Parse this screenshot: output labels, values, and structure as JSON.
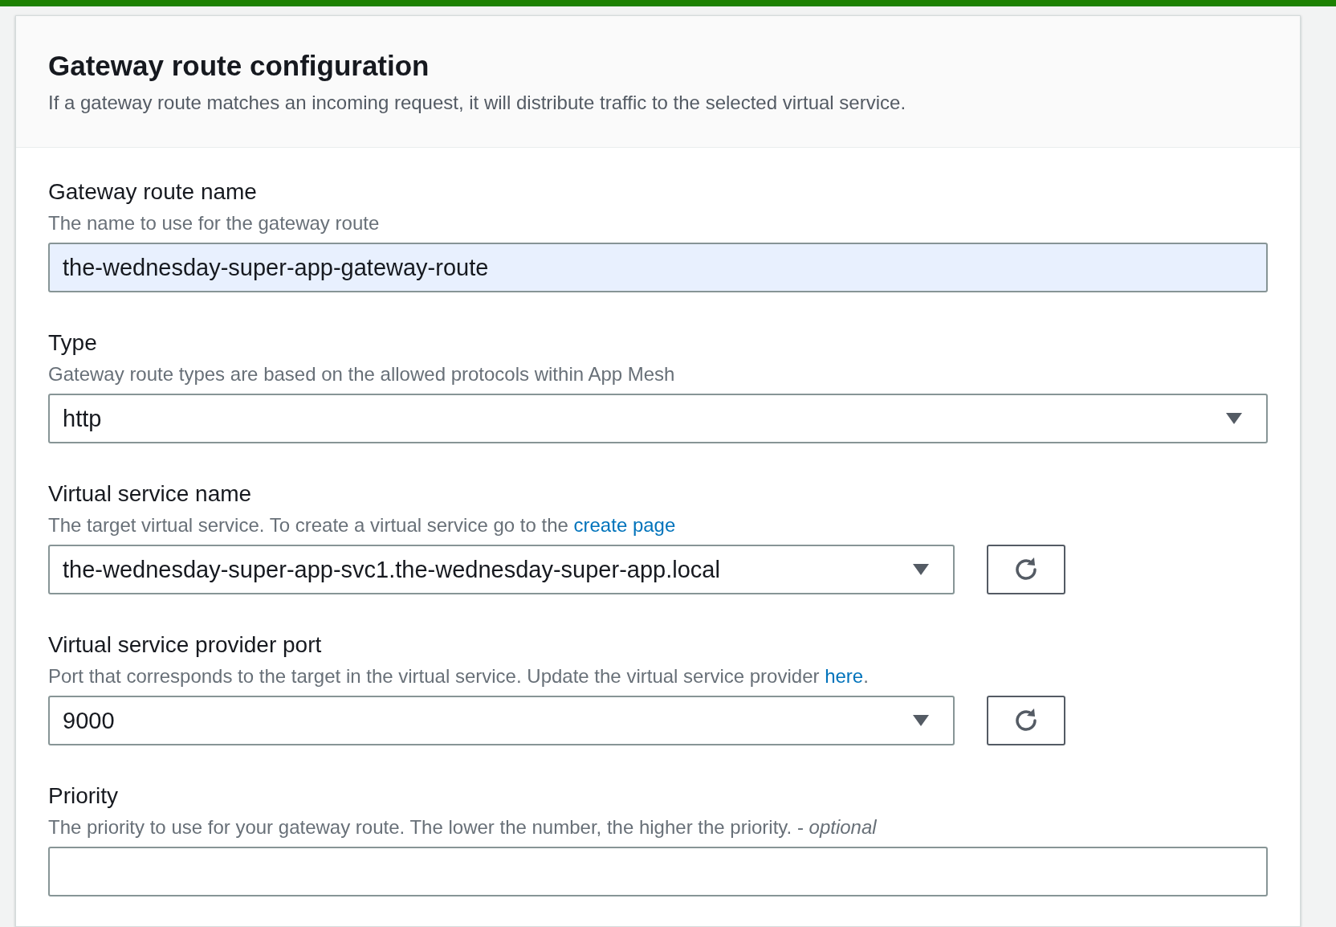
{
  "header": {
    "title": "Gateway route configuration",
    "description": "If a gateway route matches an incoming request, it will distribute traffic to the selected virtual service."
  },
  "fields": [
    {
      "kind": "text",
      "label": "Gateway route name",
      "description": "The name to use for the gateway route",
      "value": "the-wednesday-super-app-gateway-route",
      "autofilled": true,
      "refresh": false
    },
    {
      "kind": "select",
      "label": "Type",
      "description": "Gateway route types are based on the allowed protocols within App Mesh",
      "value": "http",
      "refresh": false
    },
    {
      "kind": "select",
      "label": "Virtual service name",
      "description": "The target virtual service. To create a virtual service go to the ",
      "link": "create page",
      "value": "the-wednesday-super-app-svc1.the-wednesday-super-app.local",
      "refresh": true
    },
    {
      "kind": "select",
      "label": "Virtual service provider port",
      "description": "Port that corresponds to the target in the virtual service. Update the virtual service provider ",
      "link": "here",
      "description_after": ".",
      "value": "9000",
      "refresh": true
    },
    {
      "kind": "text",
      "label": "Priority",
      "description": "The priority to use for your gateway route. The lower the number, the higher the priority. - *optional*",
      "autofilled": false,
      "refresh": false
    }
  ]
}
